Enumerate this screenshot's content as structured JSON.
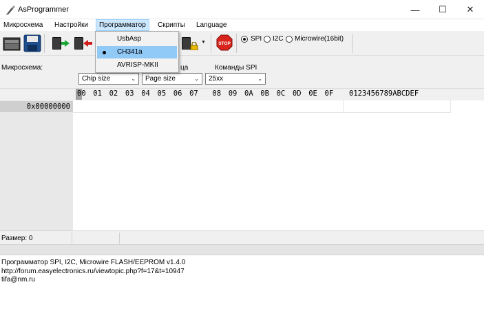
{
  "window": {
    "title": "AsProgrammer",
    "controls": {
      "minimize": "—",
      "maximize": "☐",
      "close": "✕"
    }
  },
  "menu": {
    "items": [
      "Микросхема",
      "Настройки",
      "Программатор",
      "Скрипты",
      "Language"
    ],
    "open_index": 2
  },
  "dropdown": {
    "items": [
      {
        "label": "UsbAsp",
        "selected": false
      },
      {
        "label": "CH341a",
        "selected": true
      },
      {
        "label": "AVRISP-MKII",
        "selected": false
      }
    ]
  },
  "toolbar": {
    "icons": [
      "open-file-icon",
      "save-icon",
      "read-chip-icon",
      "write-chip-icon",
      "lock-chip-icon",
      "stop-icon"
    ],
    "stop_label": "STOP",
    "protocols": [
      {
        "label": "SPI",
        "selected": true
      },
      {
        "label": "I2C",
        "selected": false
      },
      {
        "label": "Microwire(16bit)",
        "selected": false
      }
    ]
  },
  "settings": {
    "chip_label": "Микросхема:",
    "page_label_fragment": "ца",
    "spi_commands_label": "Команды SPI",
    "chip_size": "Chip size",
    "page_size": "Page size",
    "spi_commands_value": "25xx"
  },
  "hex": {
    "columns": [
      "00",
      "01",
      "02",
      "03",
      "04",
      "05",
      "06",
      "07",
      "08",
      "09",
      "0A",
      "0B",
      "0C",
      "0D",
      "0E",
      "0F"
    ],
    "ascii_header": "0123456789ABCDEF",
    "row_address": "0x00000000"
  },
  "status": {
    "size_label": "Размер: 0"
  },
  "log": {
    "lines": [
      "Программатор SPI, I2C, Microwire FLASH/EEPROM v1.4.0",
      "http://forum.easyelectronics.ru/viewtopic.php?f=17&t=10947",
      "tifa@nm.ru"
    ]
  },
  "colors": {
    "menu_highlight": "#cce8ff",
    "dropdown_selected": "#91c9f7",
    "stop_red": "#d8241c",
    "arrow_green": "#1aa636",
    "arrow_red": "#d21d1d"
  }
}
